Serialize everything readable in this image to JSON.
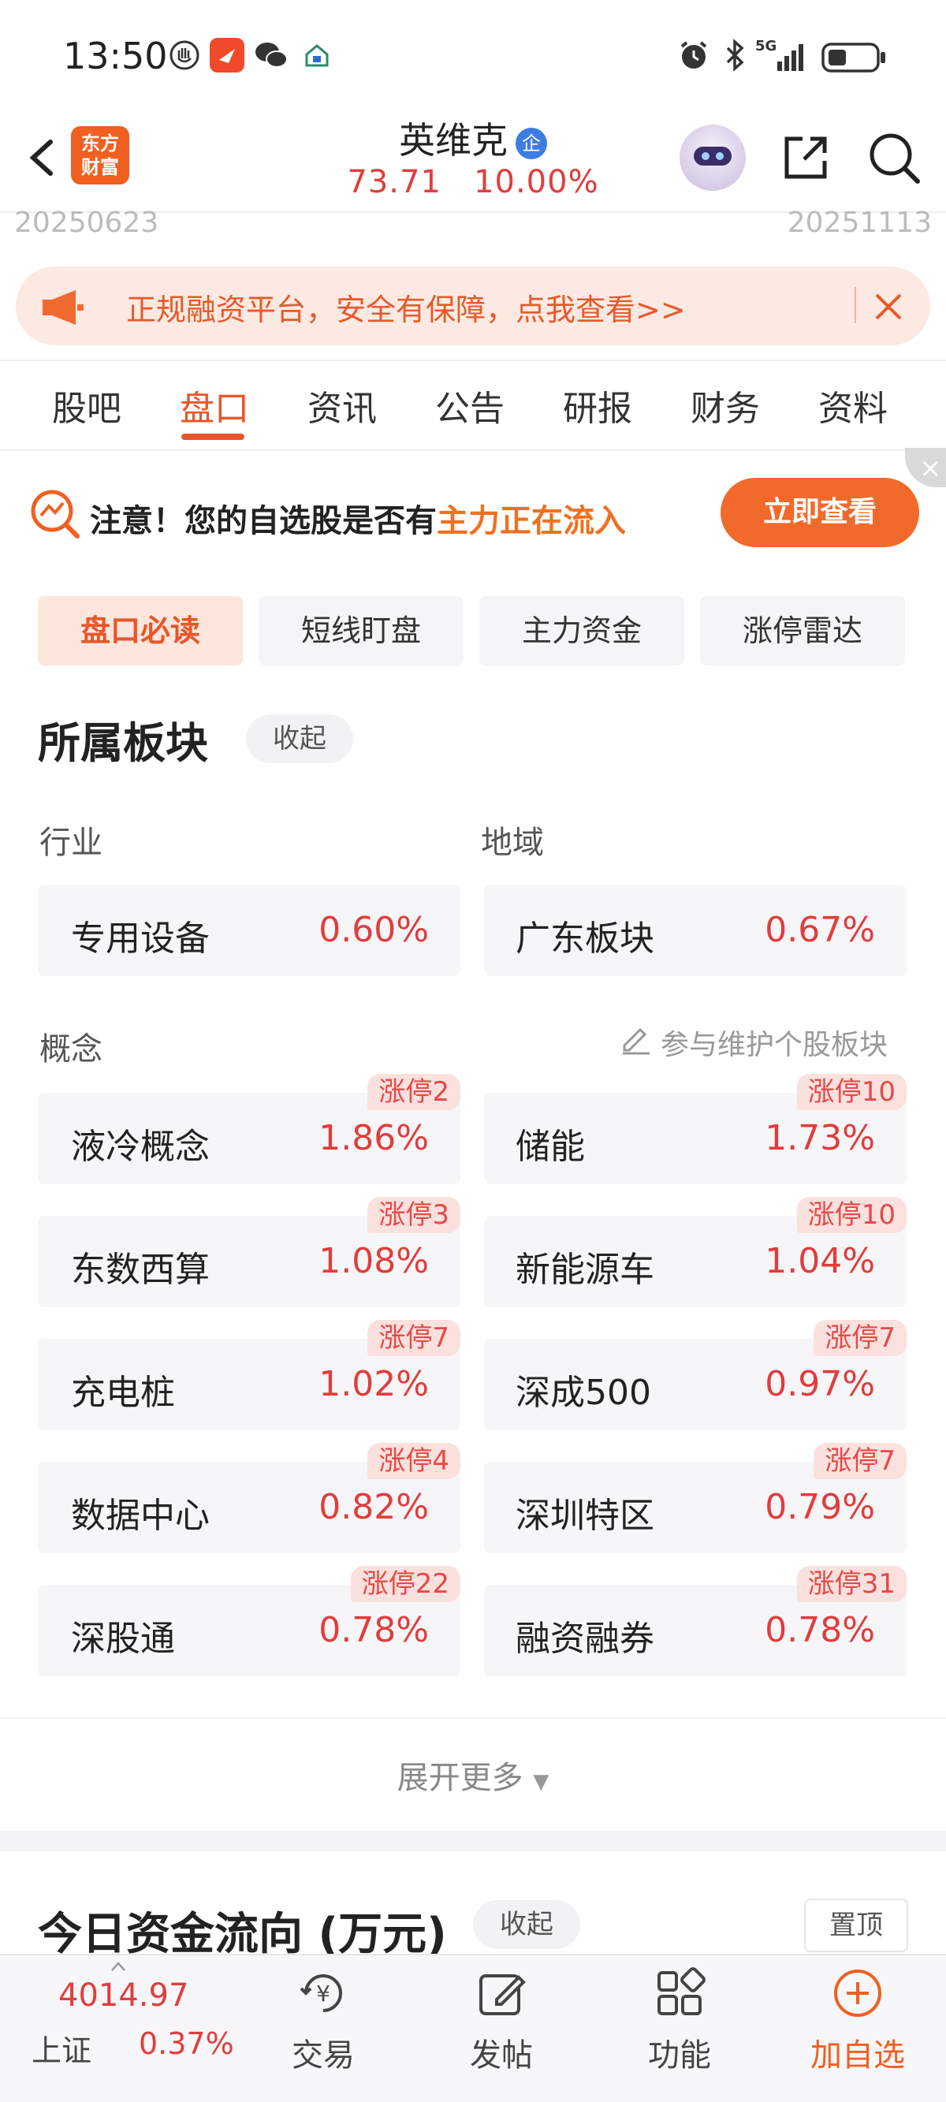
{
  "status_bar": {
    "time": "13:50",
    "icons_left": [
      "hand-icon",
      "feishu-icon",
      "wechat-icon",
      "home-icon"
    ],
    "icons_right": [
      "alarm-icon",
      "bluetooth-icon",
      "5g-signal-icon",
      "battery-icon"
    ],
    "network_label": "5G"
  },
  "header": {
    "brand_line1": "东方",
    "brand_line2": "财富",
    "stock_name": "英维克",
    "badge": "企",
    "price": "73.71",
    "change_pct": "10.00%"
  },
  "chart_dates": {
    "start": "20250623",
    "end": "20251113"
  },
  "banner": {
    "text": "正规融资平台，安全有保障，点我查看>>"
  },
  "tabs": [
    "股吧",
    "盘口",
    "资讯",
    "公告",
    "研报",
    "财务",
    "资料"
  ],
  "notice": {
    "prefix": "注意！您的自选股是否有",
    "highlight": "主力正在流入",
    "button": "立即查看"
  },
  "sub_tabs": [
    "盘口必读",
    "短线盯盘",
    "主力资金",
    "涨停雷达"
  ],
  "sector": {
    "title": "所属板块",
    "collapse": "收起",
    "industry_label": "行业",
    "region_label": "地域",
    "industry": {
      "name": "专用设备",
      "pct": "0.60%"
    },
    "region": {
      "name": "广东板块",
      "pct": "0.67%"
    },
    "concept_label": "概念",
    "maintain_link": "参与维护个股板块",
    "concepts": [
      {
        "name": "液冷概念",
        "pct": "1.86%",
        "tag": "涨停2"
      },
      {
        "name": "储能",
        "pct": "1.73%",
        "tag": "涨停10"
      },
      {
        "name": "东数西算",
        "pct": "1.08%",
        "tag": "涨停3"
      },
      {
        "name": "新能源车",
        "pct": "1.04%",
        "tag": "涨停10"
      },
      {
        "name": "充电桩",
        "pct": "1.02%",
        "tag": "涨停7"
      },
      {
        "name": "深成500",
        "pct": "0.97%",
        "tag": "涨停7"
      },
      {
        "name": "数据中心",
        "pct": "0.82%",
        "tag": "涨停4"
      },
      {
        "name": "深圳特区",
        "pct": "0.79%",
        "tag": "涨停7"
      },
      {
        "name": "深股通",
        "pct": "0.78%",
        "tag": "涨停22"
      },
      {
        "name": "融资融券",
        "pct": "0.78%",
        "tag": "涨停31"
      }
    ],
    "expand_more": "展开更多"
  },
  "fund_flow": {
    "title": "今日资金流向 (万元)",
    "collapse": "收起",
    "pin_top": "置顶"
  },
  "bottom_bar": {
    "index_value": "4014.97",
    "index_name": "上证",
    "index_pct": "0.37%",
    "items": [
      "交易",
      "发帖",
      "功能",
      "加自选"
    ]
  },
  "colors": {
    "accent": "#e8562a",
    "up": "#e23c3c",
    "brand": "#f06020"
  }
}
